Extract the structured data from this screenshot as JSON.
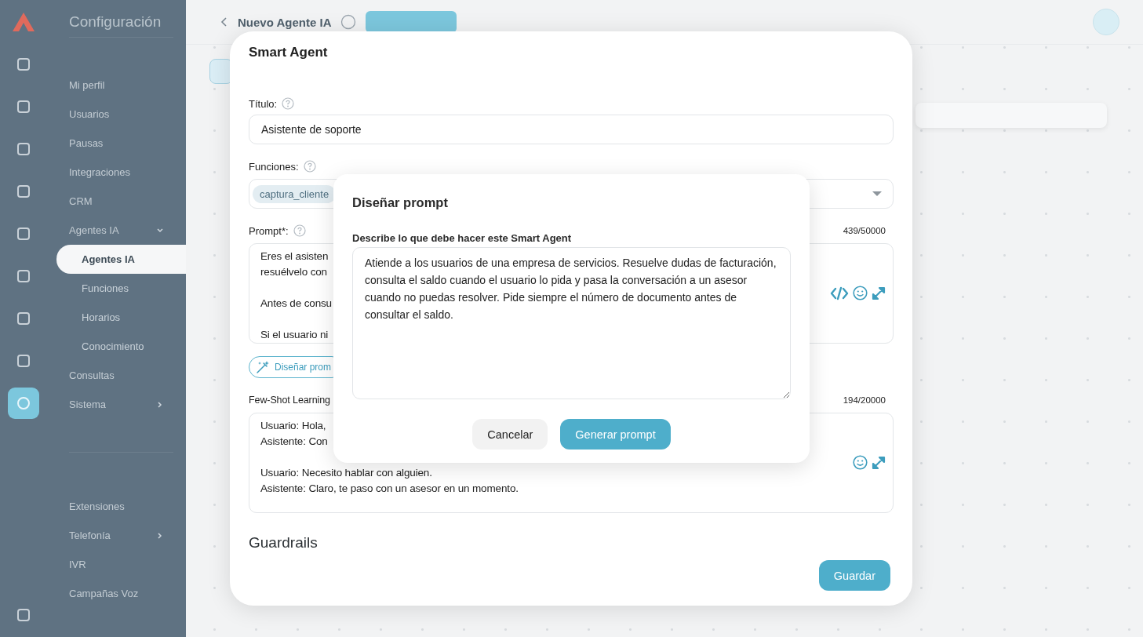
{
  "sidebar": {
    "title": "Configuración",
    "rail_icons": [
      {
        "selected": false
      },
      {
        "selected": false
      },
      {
        "selected": false
      },
      {
        "selected": false
      },
      {
        "selected": false
      },
      {
        "selected": false
      },
      {
        "selected": false
      },
      {
        "selected": false
      },
      {
        "selected": true
      },
      {
        "selected": false
      }
    ],
    "menu": [
      {
        "label": "Mi perfil",
        "selected": false
      },
      {
        "label": "Usuarios",
        "selected": false
      },
      {
        "label": "Pausas",
        "selected": false
      },
      {
        "label": "Integraciones",
        "selected": false
      },
      {
        "label": "CRM",
        "selected": false
      },
      {
        "label": "Agentes IA",
        "selected": false,
        "expanded": true,
        "children": [
          {
            "label": "Agentes IA",
            "selected": true
          },
          {
            "label": "Funciones",
            "selected": false
          },
          {
            "label": "Horarios",
            "selected": false
          },
          {
            "label": "Conocimiento",
            "selected": false
          }
        ]
      },
      {
        "label": "Consultas",
        "selected": false
      },
      {
        "label": "Sistema",
        "selected": false,
        "expanded": false
      }
    ],
    "menu_2": [
      {
        "label": "Extensiones",
        "selected": false
      },
      {
        "label": "Telefonía",
        "selected": false,
        "expanded": false
      },
      {
        "label": "IVR",
        "selected": false
      },
      {
        "label": "Campañas Voz",
        "selected": false
      }
    ]
  },
  "topbar": {
    "title": "Nuevo Agente IA"
  },
  "smart_agent": {
    "title": "Smart Agent",
    "title_field": {
      "label": "Título:",
      "value": "Asistente de soporte"
    },
    "functions_field": {
      "label": "Funciones:",
      "chips": [
        "captura_cliente"
      ]
    },
    "prompt_field": {
      "label": "Prompt*:",
      "counter": "439/50000",
      "paragraphs": [
        [
          "Eres el asisten",
          "resuélvelo con"
        ],
        [
          "Antes de consu"
        ],
        [
          "Si el usuario ni"
        ]
      ]
    },
    "design_button": "Diseñar prom",
    "few_shot_field": {
      "label": "Few-Shot Learning",
      "counter": "194/20000",
      "paragraphs": [
        [
          "Usuario: Hola,",
          "Asistente: Con"
        ],
        [
          "Usuario: Necesito hablar con alguien.",
          "Asistente: Claro, te paso con un asesor en un momento."
        ]
      ]
    },
    "guardrails_heading": "Guardrails",
    "save_button": "Guardar"
  },
  "design_dialog": {
    "title": "Diseñar prompt",
    "label": "Describe lo que debe hacer este Smart Agent",
    "value": "Atiende a los usuarios de una empresa de servicios. Resuelve dudas de facturación, consulta el saldo cuando el usuario lo pida y pasa la conversación a un asesor cuando no puedas resolver. Pide siempre el número de documento antes de consultar el saldo.",
    "buttons": [
      {
        "label": "Cancelar",
        "kind": "secondary"
      },
      {
        "label": "Generar prompt",
        "kind": "primary"
      }
    ]
  }
}
